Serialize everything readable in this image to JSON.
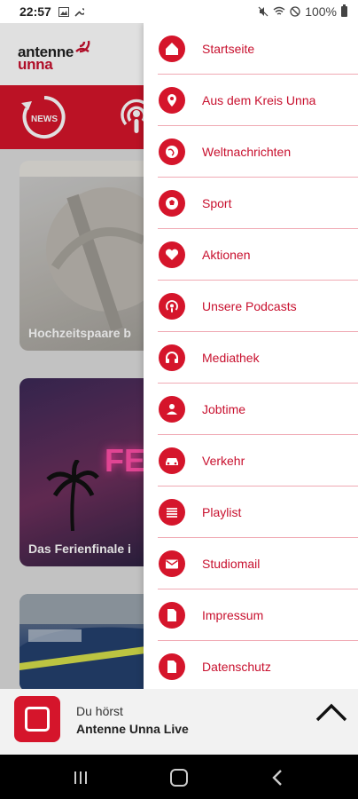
{
  "status_bar": {
    "time": "22:57",
    "battery": "100%"
  },
  "brand": {
    "logo_top": "antenne",
    "logo_bottom": "unna",
    "accent": "#d5152b"
  },
  "header_icons": {
    "news_label": "NEWS"
  },
  "cards": [
    {
      "caption": "Hochzeitspaare b"
    },
    {
      "caption": "Das Ferienfinale i",
      "overlay_text": "FE"
    },
    {
      "caption": ""
    }
  ],
  "menu": [
    {
      "label": "Startseite",
      "icon": "home-icon"
    },
    {
      "label": "Aus dem Kreis Unna",
      "icon": "location-pin-icon"
    },
    {
      "label": "Weltnachrichten",
      "icon": "globe-icon"
    },
    {
      "label": "Sport",
      "icon": "soccer-ball-icon"
    },
    {
      "label": "Aktionen",
      "icon": "heart-icon"
    },
    {
      "label": "Unsere Podcasts",
      "icon": "podcast-icon"
    },
    {
      "label": "Mediathek",
      "icon": "headphones-icon"
    },
    {
      "label": "Jobtime",
      "icon": "person-icon"
    },
    {
      "label": "Verkehr",
      "icon": "car-icon"
    },
    {
      "label": "Playlist",
      "icon": "list-icon"
    },
    {
      "label": "Studiomail",
      "icon": "mail-icon"
    },
    {
      "label": "Impressum",
      "icon": "document-icon"
    },
    {
      "label": "Datenschutz",
      "icon": "document-icon"
    }
  ],
  "player": {
    "line1": "Du hörst",
    "line2": "Antenne Unna Live"
  }
}
